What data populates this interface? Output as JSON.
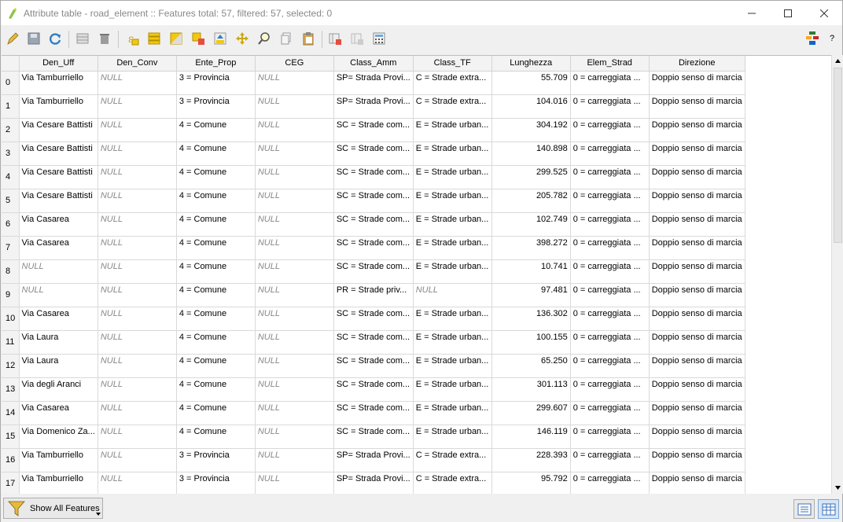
{
  "window": {
    "title": "Attribute table - road_element :: Features total: 57, filtered: 57, selected: 0"
  },
  "toolbar": {
    "icons": [
      "pencil-icon",
      "save-icon",
      "refresh-icon",
      "add-feature-icon",
      "delete-icon",
      "expression-select-icon",
      "select-all-icon",
      "invert-selection-icon",
      "deselect-icon",
      "move-selection-top-icon",
      "pan-to-selection-icon",
      "zoom-to-selection-icon",
      "copy-icon",
      "paste-icon",
      "delete-field-icon",
      "new-field-icon",
      "field-calculator-icon",
      "conditional-format-icon"
    ],
    "help_label": "?"
  },
  "table": {
    "columns": [
      "Den_Uff",
      "Den_Conv",
      "Ente_Prop",
      "CEG",
      "Class_Amm",
      "Class_TF",
      "Lunghezza",
      "Elem_Strad",
      "Direzione"
    ],
    "rows": [
      {
        "n": "0",
        "c": [
          "Via Tamburriello",
          "NULL",
          "3 = Provincia",
          "NULL",
          "SP= Strada Provi...",
          "C = Strade extra...",
          "55.709",
          "0 = carreggiata ...",
          "Doppio senso di marcia"
        ]
      },
      {
        "n": "1",
        "c": [
          "Via Tamburriello",
          "NULL",
          "3 = Provincia",
          "NULL",
          "SP= Strada Provi...",
          "C = Strade extra...",
          "104.016",
          "0 = carreggiata ...",
          "Doppio senso di marcia"
        ]
      },
      {
        "n": "2",
        "c": [
          "Via Cesare Battisti",
          "NULL",
          "4 = Comune",
          "NULL",
          "SC = Strade com...",
          "E = Strade urban...",
          "304.192",
          "0 = carreggiata ...",
          "Doppio senso di marcia"
        ]
      },
      {
        "n": "3",
        "c": [
          "Via Cesare Battisti",
          "NULL",
          "4 = Comune",
          "NULL",
          "SC = Strade com...",
          "E = Strade urban...",
          "140.898",
          "0 = carreggiata ...",
          "Doppio senso di marcia"
        ]
      },
      {
        "n": "4",
        "c": [
          "Via Cesare Battisti",
          "NULL",
          "4 = Comune",
          "NULL",
          "SC = Strade com...",
          "E = Strade urban...",
          "299.525",
          "0 = carreggiata ...",
          "Doppio senso di marcia"
        ]
      },
      {
        "n": "5",
        "c": [
          "Via Cesare Battisti",
          "NULL",
          "4 = Comune",
          "NULL",
          "SC = Strade com...",
          "E = Strade urban...",
          "205.782",
          "0 = carreggiata ...",
          "Doppio senso di marcia"
        ]
      },
      {
        "n": "6",
        "c": [
          "Via Casarea",
          "NULL",
          "4 = Comune",
          "NULL",
          "SC = Strade com...",
          "E = Strade urban...",
          "102.749",
          "0 = carreggiata ...",
          "Doppio senso di marcia"
        ]
      },
      {
        "n": "7",
        "c": [
          "Via Casarea",
          "NULL",
          "4 = Comune",
          "NULL",
          "SC = Strade com...",
          "E = Strade urban...",
          "398.272",
          "0 = carreggiata ...",
          "Doppio senso di marcia"
        ]
      },
      {
        "n": "8",
        "c": [
          "NULL",
          "NULL",
          "4 = Comune",
          "NULL",
          "SC = Strade com...",
          "E = Strade urban...",
          "10.741",
          "0 = carreggiata ...",
          "Doppio senso di marcia"
        ]
      },
      {
        "n": "9",
        "c": [
          "NULL",
          "NULL",
          "4 = Comune",
          "NULL",
          "PR = Strade priv...",
          "NULL",
          "97.481",
          "0 = carreggiata ...",
          "Doppio senso di marcia"
        ]
      },
      {
        "n": "10",
        "c": [
          "Via Casarea",
          "NULL",
          "4 = Comune",
          "NULL",
          "SC = Strade com...",
          "E = Strade urban...",
          "136.302",
          "0 = carreggiata ...",
          "Doppio senso di marcia"
        ]
      },
      {
        "n": "11",
        "c": [
          "Via Laura",
          "NULL",
          "4 = Comune",
          "NULL",
          "SC = Strade com...",
          "E = Strade urban...",
          "100.155",
          "0 = carreggiata ...",
          "Doppio senso di marcia"
        ]
      },
      {
        "n": "12",
        "c": [
          "Via Laura",
          "NULL",
          "4 = Comune",
          "NULL",
          "SC = Strade com...",
          "E = Strade urban...",
          "65.250",
          "0 = carreggiata ...",
          "Doppio senso di marcia"
        ]
      },
      {
        "n": "13",
        "c": [
          "Via degli Aranci",
          "NULL",
          "4 = Comune",
          "NULL",
          "SC = Strade com...",
          "E = Strade urban...",
          "301.113",
          "0 = carreggiata ...",
          "Doppio senso di marcia"
        ]
      },
      {
        "n": "14",
        "c": [
          "Via Casarea",
          "NULL",
          "4 = Comune",
          "NULL",
          "SC = Strade com...",
          "E = Strade urban...",
          "299.607",
          "0 = carreggiata ...",
          "Doppio senso di marcia"
        ]
      },
      {
        "n": "15",
        "c": [
          "Via Domenico Za...",
          "NULL",
          "4 = Comune",
          "NULL",
          "SC = Strade com...",
          "E = Strade urban...",
          "146.119",
          "0 = carreggiata ...",
          "Doppio senso di marcia"
        ]
      },
      {
        "n": "16",
        "c": [
          "Via Tamburriello",
          "NULL",
          "3 = Provincia",
          "NULL",
          "SP= Strada Provi...",
          "C = Strade extra...",
          "228.393",
          "0 = carreggiata ...",
          "Doppio senso di marcia"
        ]
      },
      {
        "n": "17",
        "c": [
          "Via Tamburriello",
          "NULL",
          "3 = Provincia",
          "NULL",
          "SP= Strada Provi...",
          "C = Strade extra...",
          "95.792",
          "0 = carreggiata ...",
          "Doppio senso di marcia"
        ]
      }
    ]
  },
  "bottom": {
    "show_all_label": "Show All Features"
  }
}
